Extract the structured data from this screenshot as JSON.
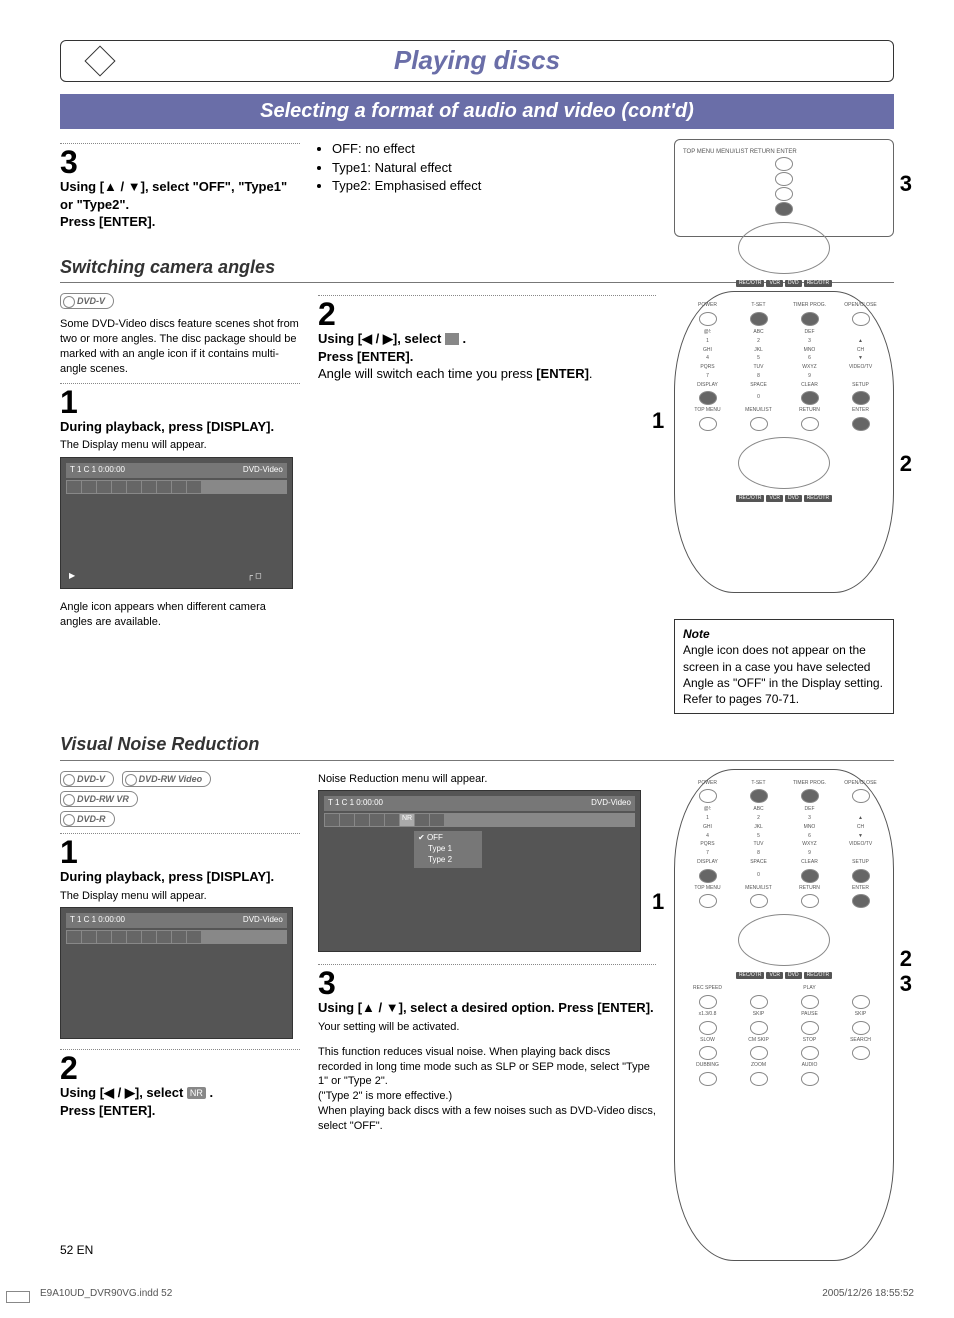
{
  "header": {
    "title": "Playing discs",
    "subtitle": "Selecting a format of audio and video (cont'd)"
  },
  "step3a": {
    "num": "3",
    "line1": "Using [▲ / ▼], select \"OFF\", \"Type1\" or \"Type2\".",
    "line2": "Press [ENTER].",
    "bullet1": "OFF:   no effect",
    "bullet2": "Type1: Natural effect",
    "bullet3": "Type2: Emphasised effect"
  },
  "switching": {
    "title": "Switching camera angles",
    "badge": "DVD-V",
    "intro": "Some DVD-Video discs feature scenes shot from two or more angles. The disc package should be marked with an angle icon if it contains multi-angle scenes.",
    "s1num": "1",
    "s1a": "During playback, press [DISPLAY].",
    "s1b": "The Display menu will appear.",
    "osd_top_left": "T  1  C  1      0:00:00",
    "osd_top_right": "DVD-Video",
    "caption": "Angle icon appears when different camera angles are available.",
    "s2num": "2",
    "s2a": "Using [◀ / ▶], select ",
    "s2b": " .",
    "s2c": "Press [ENTER].",
    "s2d": "Angle will switch each time you press ",
    "s2e": "[ENTER]",
    "s2f": "."
  },
  "note": {
    "label": "Note",
    "body": "Angle icon does not appear on the screen in a case you have selected Angle as \"OFF\" in the Display setting.\nRefer to pages 70-71."
  },
  "vnr": {
    "title": "Visual Noise Reduction",
    "badges": [
      "DVD-V",
      "DVD-RW Video",
      "DVD-RW VR",
      "DVD-R"
    ],
    "s1num": "1",
    "s1a": "During playback, press [DISPLAY].",
    "s1b": "The Display menu will appear.",
    "s2num": "2",
    "s2a": "Using [◀ / ▶], select ",
    "s2b": " .",
    "s2c": "Press [ENTER].",
    "mid_caption": "Noise Reduction menu will appear.",
    "menu_items": [
      "OFF",
      "Type 1",
      "Type 2"
    ],
    "s3num": "3",
    "s3a": "Using [▲ / ▼], select a desired option. Press [ENTER].",
    "s3b": "Your setting will be activated.",
    "para": "This function reduces visual noise. When playing back discs recorded in long time mode such as SLP or SEP mode, select \"Type 1\" or \"Type 2\".\n(\"Type 2\" is more effective.)\nWhen playing back discs with a few noises such as DVD-Video discs, select \"OFF\"."
  },
  "remote_top": {
    "labels": [
      "TOP MENU",
      "MENU/LIST",
      "RETURN",
      "ENTER",
      "REC/OTR",
      "VCR",
      "DVD",
      "REC/OTR"
    ],
    "callout": "3"
  },
  "remote_mid": {
    "labels_row1": [
      "POWER",
      "T-SET",
      "TIMER PROG.",
      "OPEN/CLOSE"
    ],
    "keypad": [
      "@!:",
      "ABC",
      "DEF",
      "",
      "1",
      "2",
      "3",
      "▲",
      "GHI",
      "JKL",
      "MNO",
      "CH",
      "4",
      "5",
      "6",
      "▼",
      "PQRS",
      "TUV",
      "WXYZ",
      "VIDEO/TV",
      "7",
      "8",
      "9",
      "",
      "DISPLAY",
      "SPACE",
      "CLEAR",
      "SETUP",
      "",
      "0",
      "",
      "",
      "TOP MENU",
      "MENU/LIST",
      "RETURN",
      "ENTER"
    ],
    "callout1": "1",
    "callout2": "2"
  },
  "remote_low": {
    "extra": [
      "REC SPEED",
      "PLAY",
      "x1.3/0.8",
      "SKIP",
      "PAUSE",
      "SKIP",
      "SLOW",
      "CM SKIP",
      "STOP",
      "SEARCH",
      "DUBBING",
      "ZOOM",
      "AUDIO"
    ],
    "callout1": "1",
    "callout2": "2",
    "callout3": "3"
  },
  "footer": {
    "page": "52   EN",
    "file": "E9A10UD_DVR90VG.indd   52",
    "stamp": "2005/12/26   18:55:52"
  }
}
